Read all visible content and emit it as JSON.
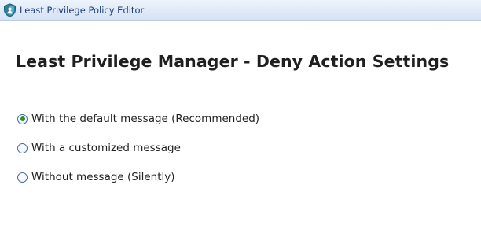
{
  "window": {
    "title": "Least Privilege Policy Editor",
    "icon": "shield-icon"
  },
  "main": {
    "heading": "Least Privilege Manager - Deny Action Settings",
    "options": [
      {
        "label": "With the default message (Recommended)",
        "selected": true
      },
      {
        "label": "With a customized message",
        "selected": false
      },
      {
        "label": "Without message (Silently)",
        "selected": false
      }
    ]
  },
  "colors": {
    "accent_green": "#2a8f2f",
    "titlebar": "#dfe9f7",
    "divider": "#b4d2e8"
  }
}
